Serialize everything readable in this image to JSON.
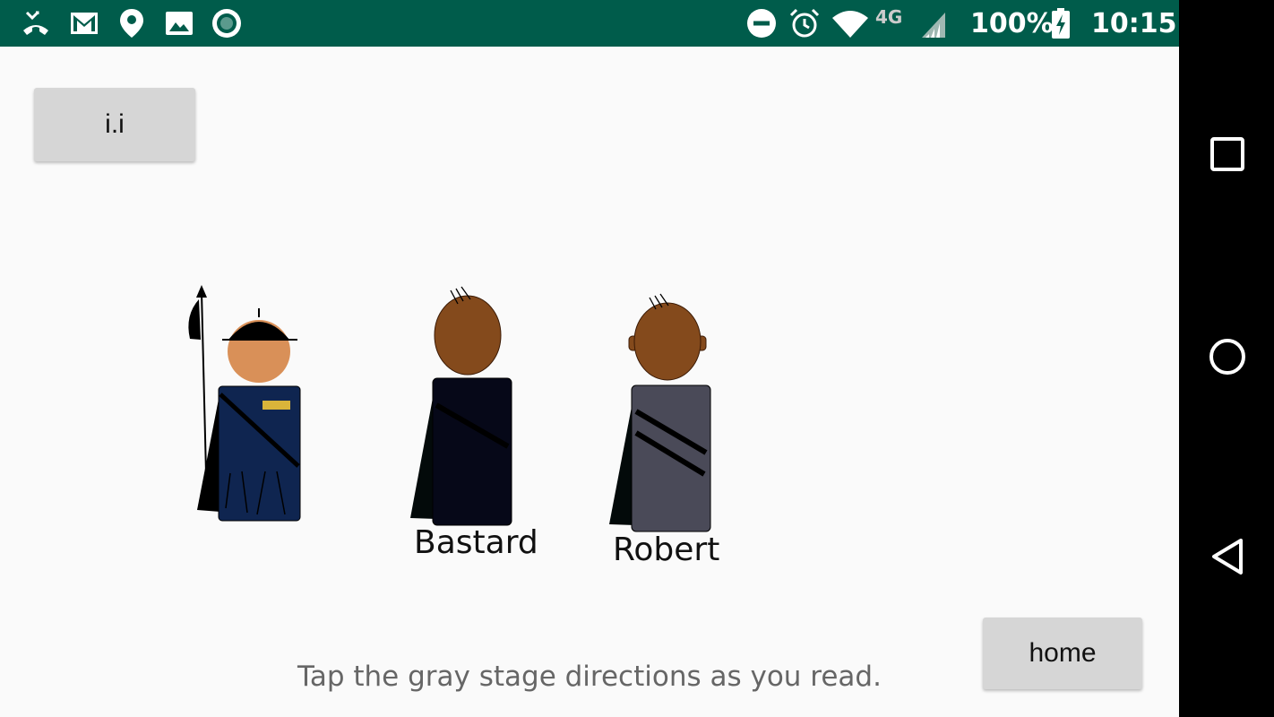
{
  "status_bar": {
    "battery": "100%",
    "time": "10:15",
    "network": "4G",
    "icons": [
      "missed-call-icon",
      "gmail-icon",
      "location-pin-icon",
      "image-icon",
      "record-icon",
      "do-not-disturb-icon",
      "alarm-icon",
      "wifi-icon",
      "signal-icon",
      "battery-charging-icon"
    ]
  },
  "buttons": {
    "act_label": "i.i",
    "home_label": "home"
  },
  "characters": [
    {
      "name": "",
      "role": "guard"
    },
    {
      "name": "Bastard",
      "role": "bastard"
    },
    {
      "name": "Robert",
      "role": "robert"
    }
  ],
  "instruction": "Tap the gray stage directions as you read.",
  "colors": {
    "status_bar": "#005c4b",
    "guard_tunic": "#0f2550",
    "bastard_tunic": "#060818",
    "robert_tunic": "#4a4a58",
    "skin_light": "#d99058",
    "skin_dark": "#844a1c",
    "button_bg": "#d6d6d6"
  }
}
